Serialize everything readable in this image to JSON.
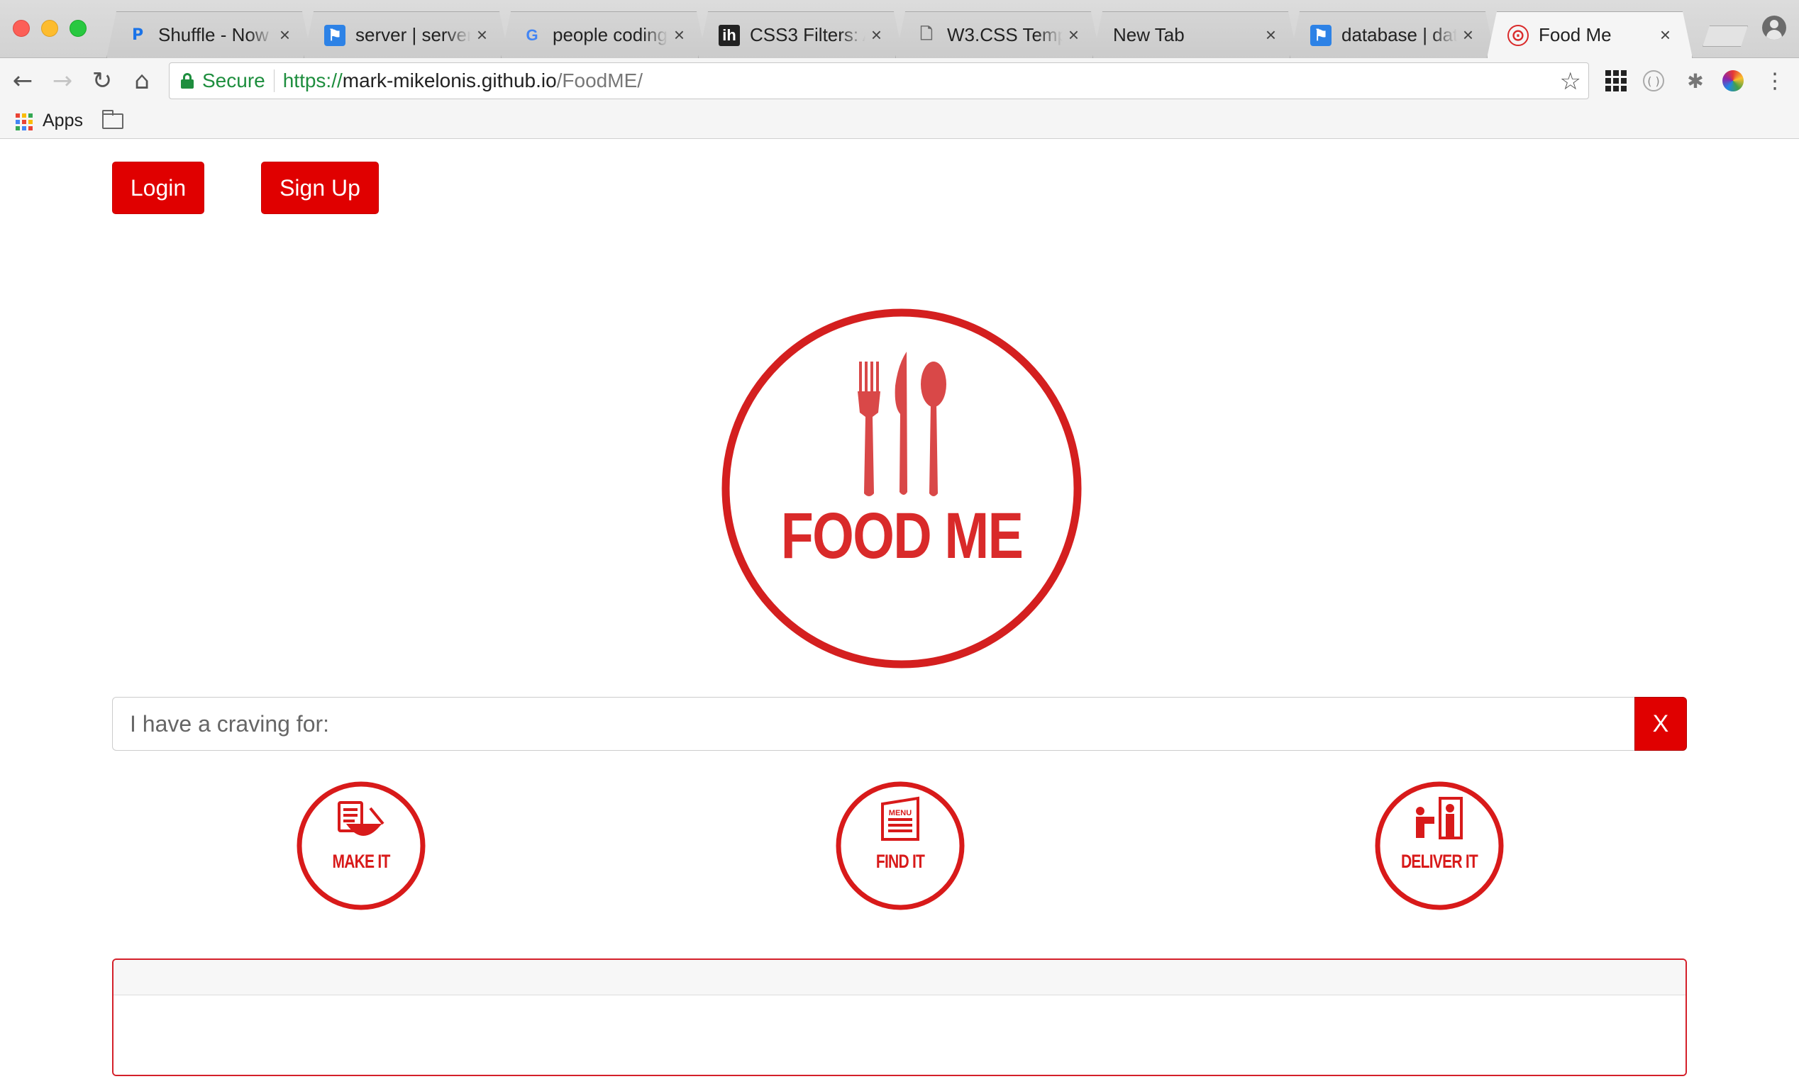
{
  "browser": {
    "tabs": [
      {
        "title": "Shuffle - Now P",
        "favicon": "p-icon"
      },
      {
        "title": "server | server",
        "favicon": "flag-icon"
      },
      {
        "title": "people coding",
        "favicon": "google-icon"
      },
      {
        "title": "CSS3 Filters: A",
        "favicon": "ih-icon"
      },
      {
        "title": "W3.CSS Templa",
        "favicon": "document-icon"
      },
      {
        "title": "New Tab",
        "favicon": ""
      },
      {
        "title": "database | data",
        "favicon": "flag-icon"
      },
      {
        "title": "Food Me",
        "favicon": "foodme-icon",
        "active": true
      }
    ],
    "tab_close_glyph": "×",
    "address_bar": {
      "secure_label": "Secure",
      "scheme": "https://",
      "host": "mark-mikelonis.github.io",
      "path": "/FoodME/"
    },
    "bookmarks": {
      "apps_label": "Apps"
    }
  },
  "page": {
    "header": {
      "login_label": "Login",
      "signup_label": "Sign Up"
    },
    "logo": {
      "text": "FOOD ME",
      "color": "#d92a2a"
    },
    "search": {
      "placeholder": "I have a craving for:",
      "value": "",
      "clear_label": "X"
    },
    "options": [
      {
        "label": "MAKE IT",
        "icon": "cookbook-bowl-icon"
      },
      {
        "label": "FIND IT",
        "icon": "menu-icon"
      },
      {
        "label": "DELIVER IT",
        "icon": "delivery-person-icon"
      }
    ],
    "accent_color": "#e00000"
  }
}
